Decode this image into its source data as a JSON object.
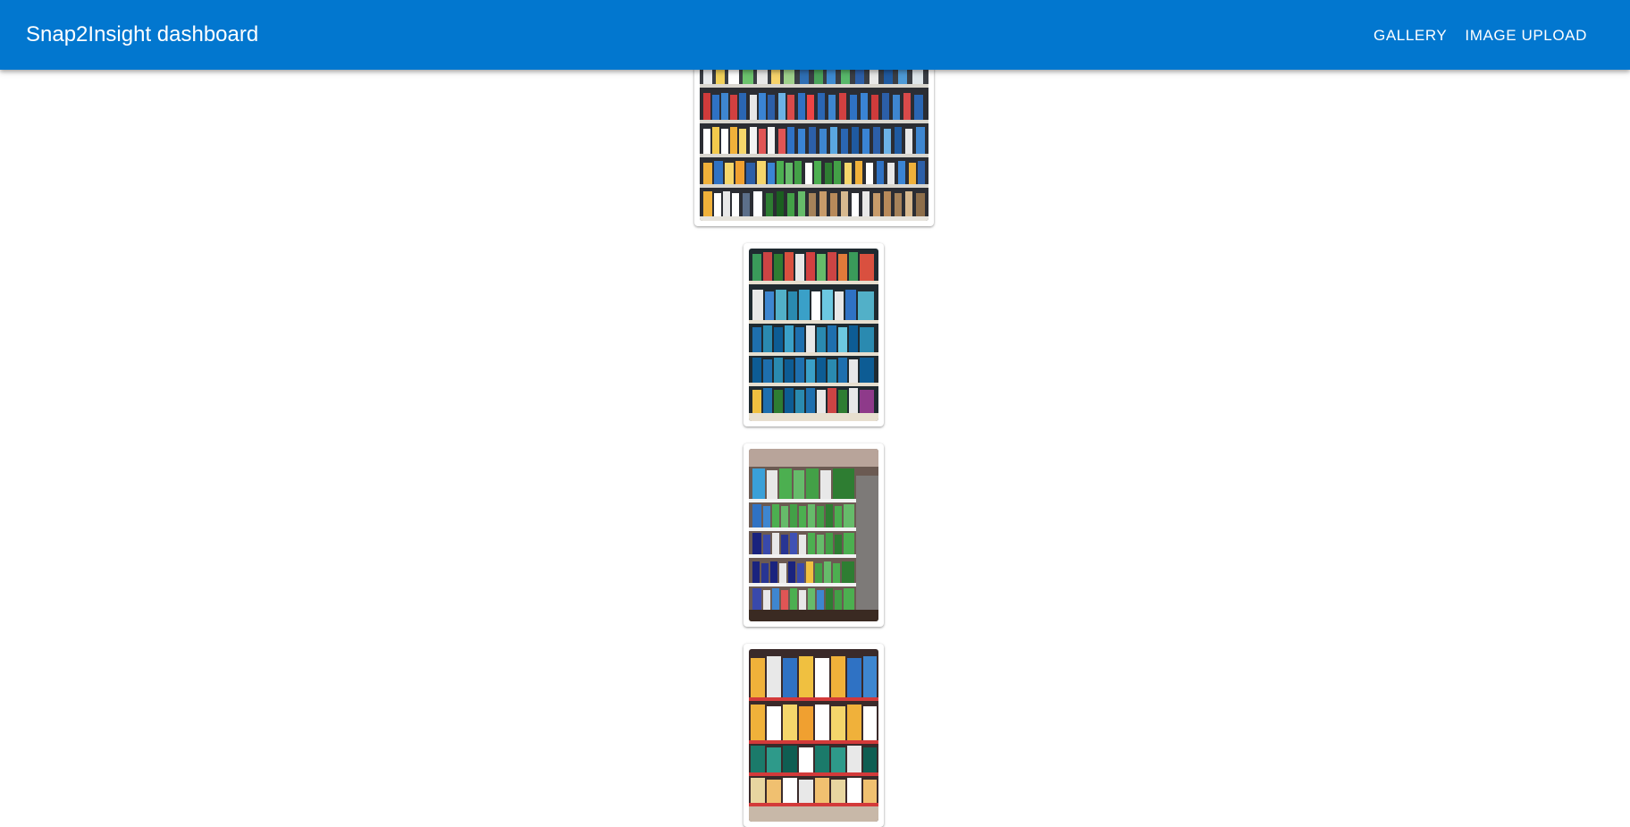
{
  "app": {
    "title": "Snap2Insight dashboard"
  },
  "nav": {
    "gallery_label": "GALLERY",
    "upload_label": "IMAGE UPLOAD"
  },
  "colors": {
    "appbar": "#0277cf"
  },
  "gallery": {
    "images": [
      {
        "name": "shelf-photo-1",
        "orientation": "landscape"
      },
      {
        "name": "shelf-photo-2",
        "orientation": "portrait"
      },
      {
        "name": "shelf-photo-3",
        "orientation": "portrait"
      },
      {
        "name": "shelf-photo-4",
        "orientation": "portrait"
      }
    ]
  }
}
